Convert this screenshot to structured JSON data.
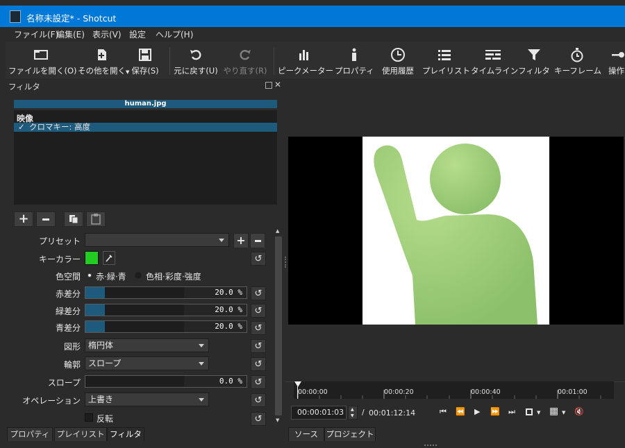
{
  "window": {
    "title": "名称未設定* - Shotcut",
    "accent": "#0078d7"
  },
  "menu": [
    "ファイル(F)",
    "編集(E)",
    "表示(V)",
    "設定",
    "ヘルプ(H)"
  ],
  "toolbar": {
    "open_file": "ファイルを開く(O)",
    "open_other": "その他を開く",
    "save": "保存(S)",
    "undo": "元に戻す(U)",
    "redo": "やり直す(R)",
    "peak_meter": "ピークメーター",
    "properties": "プロパティ",
    "recent": "使用履歴",
    "playlist": "プレイリスト",
    "timeline": "タイムライン",
    "filters": "フィルタ",
    "keyframes": "キーフレーム",
    "operation": "操作"
  },
  "filters_panel": {
    "title": "フィルタ",
    "clip_name": "human.jpg",
    "section": "映像",
    "filter_item": "クロマキー: 高度",
    "filter_checked": "✓"
  },
  "props": {
    "preset_label": "プリセット",
    "preset_value": "",
    "keycolor_label": "キーカラー",
    "keycolor": "#22cc22",
    "colorspace_label": "色空間",
    "colorspace_opt1": "赤·緑·青",
    "colorspace_opt2": "色相·彩度·強度",
    "red_label": "赤差分",
    "red_value": "20.0 %",
    "red_fraction": 0.2,
    "green_label": "緑差分",
    "green_value": "20.0 %",
    "green_fraction": 0.2,
    "blue_label": "青差分",
    "blue_value": "20.0 %",
    "blue_fraction": 0.2,
    "shape_label": "図形",
    "shape_value": "楕円体",
    "edge_label": "輪郭",
    "edge_value": "スロープ",
    "slope_label": "スロープ",
    "slope_value": "0.0 %",
    "operation_label": "オペレーション",
    "operation_value": "上書き",
    "invert_label": "反転"
  },
  "left_tabs": [
    "プロパティ",
    "プレイリスト",
    "フィルタ"
  ],
  "right_tabs": [
    "ソース",
    "プロジェクト"
  ],
  "timeline": {
    "ticks": [
      "00:00:00",
      "00:00:20",
      "00:00:40",
      "00:01:00"
    ],
    "current": "00:00:01:03",
    "separator": "/",
    "duration": "00:01:12:14"
  }
}
